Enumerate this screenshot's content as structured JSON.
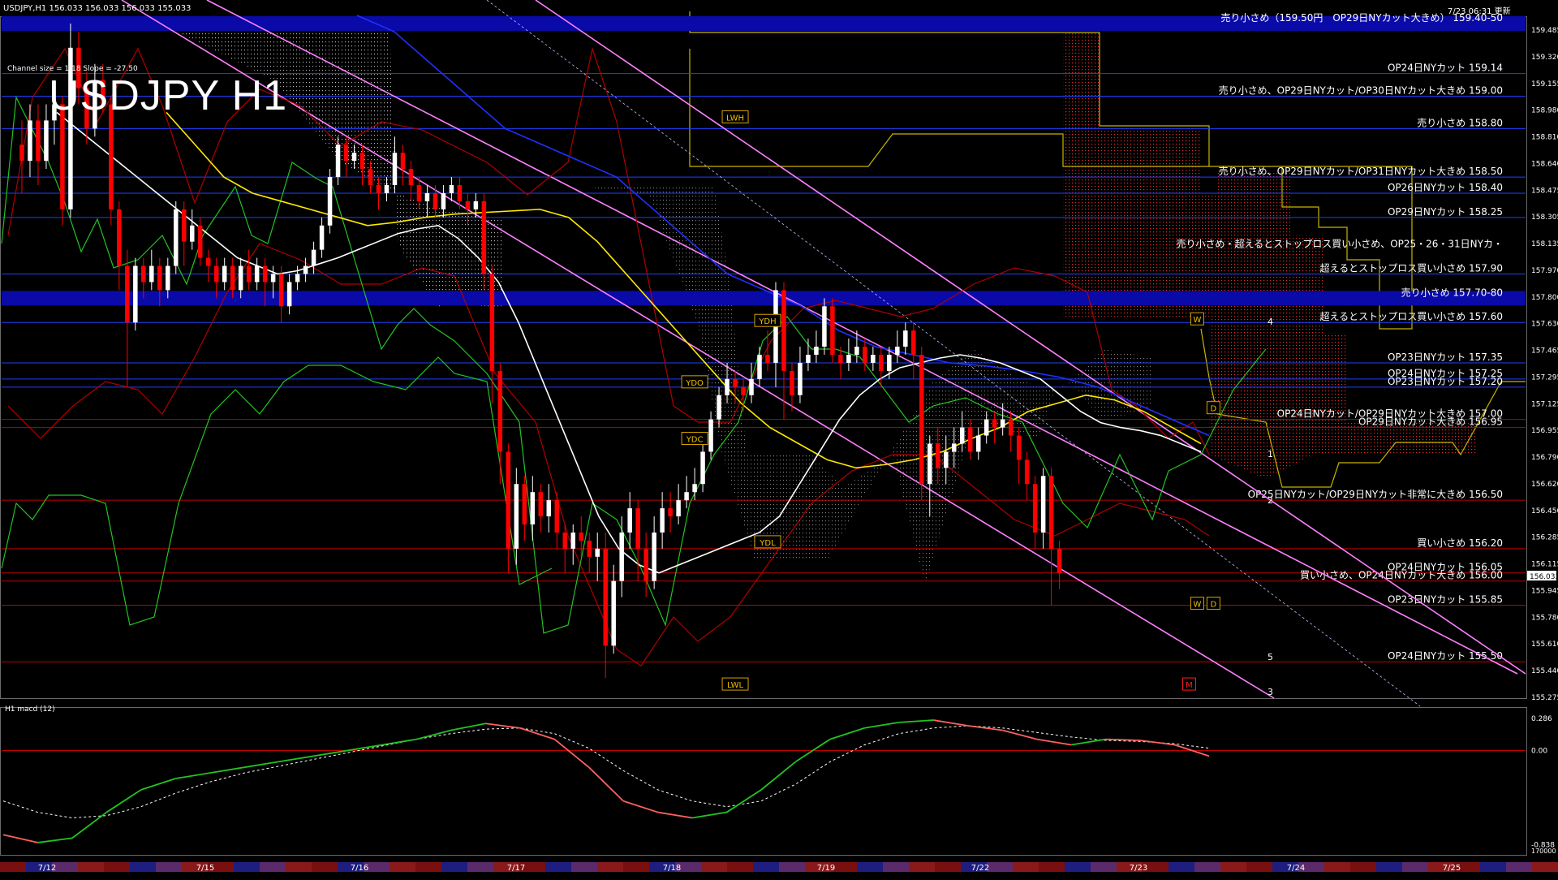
{
  "header": {
    "symbol_info": "USDJPY,H1  156.033 156.033 156.033 155.033",
    "update_time": "7/23 06:31 更新",
    "channel_info": "Channel size = 1.18 Slope = -27.50",
    "title": "USDJPY H1",
    "macd_label": "H1  macd (12)"
  },
  "colors": {
    "background": "#000000",
    "bull_candle": "#ffffff",
    "bear_candle": "#ff0000",
    "level_line_blue": "#1f3fff",
    "level_line_red": "#c00000",
    "band_blue": "#0a0aa8",
    "cloud_dots": "#ff3030",
    "channel_pink": "#ff80ff",
    "ma_white": "#ffffff",
    "ma_yellow": "#ffea00",
    "ma_blue": "#2030ff",
    "green_line": "#22c322",
    "kijun_yellow": "#c8b400"
  },
  "chart_data": {
    "type": "candlestick",
    "symbol": "USDJPY",
    "timeframe": "H1",
    "last_price": 156.033,
    "price_axis": {
      "min": 155.275,
      "max": 159.485,
      "ticks": [
        "159.485",
        "159.320",
        "159.155",
        "158.980",
        "158.810",
        "158.640",
        "158.475",
        "158.305",
        "158.135",
        "157.970",
        "157.800",
        "157.630",
        "157.465",
        "157.295",
        "157.125",
        "156.955",
        "156.790",
        "156.620",
        "156.450",
        "156.285",
        "156.115",
        "155.945",
        "155.780",
        "155.610",
        "155.440",
        "155.275"
      ]
    },
    "date_axis": [
      "7/12",
      "7/15",
      "7/16",
      "7/17",
      "7/18",
      "7/19",
      "7/22",
      "7/23",
      "7/24",
      "7/25"
    ],
    "price_labels": [
      {
        "text": "売り小さめ（159.50円　OP29日NYカット大きめ） 159.40-50",
        "price": 159.45,
        "kind": "band"
      },
      {
        "text": "OP24日NYカット 159.14",
        "price": 159.14,
        "kind": "blue"
      },
      {
        "text": "売り小さめ、OP29日NYカット/OP30日NYカット大きめ 159.00",
        "price": 159.0,
        "kind": "blue"
      },
      {
        "text": "売り小さめ 158.80",
        "price": 158.8,
        "kind": "blue"
      },
      {
        "text": "売り小さめ、OP29日NYカット/OP31日NYカット大きめ 158.50",
        "price": 158.5,
        "kind": "blue"
      },
      {
        "text": "OP26日NYカット 158.40",
        "price": 158.4,
        "kind": "blue"
      },
      {
        "text": "OP29日NYカット 158.25",
        "price": 158.25,
        "kind": "blue"
      },
      {
        "text": "売り小さめ・超えるとストップロス買い小さめ、OP25・26・31日NYカ・",
        "price": 158.05,
        "kind": "none"
      },
      {
        "text": "超えるとストップロス買い小さめ 157.90",
        "price": 157.9,
        "kind": "blue"
      },
      {
        "text": "売り小さめ 157.70-80",
        "price": 157.75,
        "kind": "band"
      },
      {
        "text": "超えるとストップロス買い小さめ 157.60",
        "price": 157.6,
        "kind": "blue"
      },
      {
        "text": "OP23日NYカット 157.35",
        "price": 157.35,
        "kind": "blue"
      },
      {
        "text": "OP24日NYカット 157.25",
        "price": 157.25,
        "kind": "blue"
      },
      {
        "text": "OP23日NYカット 157.20",
        "price": 157.2,
        "kind": "blue"
      },
      {
        "text": "OP24日NYカット/OP29日NYカット大きめ 157.00",
        "price": 157.0,
        "kind": "red"
      },
      {
        "text": "OP29日NYカット大きめ 156.95",
        "price": 156.95,
        "kind": "red"
      },
      {
        "text": "OP25日NYカット/OP29日NYカット非常に大きめ 156.50",
        "price": 156.5,
        "kind": "red"
      },
      {
        "text": "買い小さめ 156.20",
        "price": 156.2,
        "kind": "red"
      },
      {
        "text": "OP24日NYカット 156.05",
        "price": 156.05,
        "kind": "red"
      },
      {
        "text": "買い小さめ、OP24日NYカット大きめ 156.00",
        "price": 156.0,
        "kind": "red"
      },
      {
        "text": "OP23日NYカット 155.85",
        "price": 155.85,
        "kind": "red"
      },
      {
        "text": "OP24日NYカット 155.50",
        "price": 155.5,
        "kind": "red"
      }
    ],
    "chart_tags": [
      {
        "text": "LWH",
        "price": 158.87,
        "bar": 88
      },
      {
        "text": "YDH",
        "price": 157.61,
        "bar": 92
      },
      {
        "text": "YDO",
        "price": 157.23,
        "bar": 83
      },
      {
        "text": "YDC",
        "price": 156.88,
        "bar": 83
      },
      {
        "text": "YDL",
        "price": 156.24,
        "bar": 92
      },
      {
        "text": "LWL",
        "price": 155.36,
        "bar": 88
      },
      {
        "text": "W",
        "price": 157.62,
        "bar": 145
      },
      {
        "text": "D",
        "price": 157.07,
        "bar": 147
      },
      {
        "text": "W",
        "price": 155.86,
        "bar": 145
      },
      {
        "text": "D",
        "price": 155.86,
        "bar": 147
      },
      {
        "text": "M",
        "price": 155.36,
        "bar": 144
      }
    ],
    "wave_labels": [
      "4",
      "1",
      "2",
      "5",
      "3"
    ],
    "candles": [
      [
        158.7,
        158.6,
        158.85,
        158.4
      ],
      [
        158.6,
        158.85,
        158.95,
        158.5
      ],
      [
        158.85,
        158.6,
        158.95,
        158.45
      ],
      [
        158.6,
        158.85,
        158.95,
        158.55
      ],
      [
        158.85,
        158.95,
        159.1,
        158.7
      ],
      [
        158.95,
        158.3,
        159.0,
        158.2
      ],
      [
        158.3,
        159.3,
        159.45,
        158.25
      ],
      [
        159.3,
        159.05,
        159.4,
        158.95
      ],
      [
        159.05,
        158.8,
        159.15,
        158.7
      ],
      [
        158.8,
        159.1,
        159.2,
        158.75
      ],
      [
        159.1,
        158.95,
        159.2,
        158.9
      ],
      [
        158.95,
        158.3,
        159.0,
        158.2
      ],
      [
        158.3,
        157.95,
        158.35,
        157.8
      ],
      [
        157.95,
        157.6,
        158.05,
        157.2
      ],
      [
        157.6,
        157.95,
        158.0,
        157.55
      ],
      [
        157.95,
        157.85,
        158.0,
        157.75
      ],
      [
        157.85,
        157.95,
        158.05,
        157.8
      ],
      [
        157.95,
        157.8,
        158.0,
        157.7
      ],
      [
        157.8,
        157.95,
        158.0,
        157.75
      ],
      [
        157.95,
        158.3,
        158.35,
        157.9
      ],
      [
        158.3,
        158.1,
        158.35,
        157.95
      ],
      [
        158.1,
        158.2,
        158.3,
        158.05
      ],
      [
        158.2,
        158.0,
        158.25,
        157.95
      ],
      [
        158.0,
        157.95,
        158.05,
        157.85
      ],
      [
        157.95,
        157.85,
        158.0,
        157.75
      ],
      [
        157.85,
        157.95,
        158.0,
        157.8
      ],
      [
        157.95,
        157.8,
        158.0,
        157.75
      ],
      [
        157.8,
        157.95,
        158.0,
        157.75
      ],
      [
        157.95,
        157.85,
        158.05,
        157.8
      ],
      [
        157.85,
        157.95,
        158.0,
        157.8
      ],
      [
        157.95,
        157.85,
        158.0,
        157.7
      ],
      [
        157.85,
        157.9,
        157.95,
        157.75
      ],
      [
        157.9,
        157.7,
        157.95,
        157.6
      ],
      [
        157.7,
        157.85,
        157.9,
        157.65
      ],
      [
        157.85,
        157.9,
        157.95,
        157.8
      ],
      [
        157.9,
        157.95,
        158.0,
        157.85
      ],
      [
        157.95,
        158.05,
        158.1,
        157.9
      ],
      [
        158.05,
        158.2,
        158.25,
        158.0
      ],
      [
        158.2,
        158.5,
        158.55,
        158.15
      ],
      [
        158.5,
        158.7,
        158.75,
        158.45
      ],
      [
        158.7,
        158.6,
        158.75,
        158.5
      ],
      [
        158.6,
        158.65,
        158.7,
        158.55
      ],
      [
        158.65,
        158.55,
        158.7,
        158.45
      ],
      [
        158.55,
        158.45,
        158.6,
        158.4
      ],
      [
        158.45,
        158.4,
        158.5,
        158.3
      ],
      [
        158.4,
        158.45,
        158.5,
        158.35
      ],
      [
        158.45,
        158.65,
        158.75,
        158.4
      ],
      [
        158.65,
        158.55,
        158.7,
        158.45
      ],
      [
        158.55,
        158.45,
        158.6,
        158.35
      ],
      [
        158.45,
        158.35,
        158.5,
        158.3
      ],
      [
        158.35,
        158.4,
        158.45,
        158.25
      ],
      [
        158.4,
        158.3,
        158.45,
        158.25
      ],
      [
        158.3,
        158.4,
        158.45,
        158.25
      ],
      [
        158.4,
        158.45,
        158.5,
        158.35
      ],
      [
        158.45,
        158.35,
        158.5,
        158.3
      ],
      [
        158.35,
        158.3,
        158.4,
        158.2
      ],
      [
        158.3,
        158.35,
        158.4,
        158.25
      ],
      [
        158.35,
        157.9,
        158.4,
        157.8
      ],
      [
        157.9,
        157.3,
        157.95,
        157.1
      ],
      [
        157.3,
        156.8,
        157.35,
        156.6
      ],
      [
        156.8,
        156.2,
        156.85,
        156.05
      ],
      [
        156.2,
        156.6,
        156.7,
        156.1
      ],
      [
        156.6,
        156.35,
        156.65,
        156.25
      ],
      [
        156.35,
        156.55,
        156.65,
        156.25
      ],
      [
        156.55,
        156.4,
        156.6,
        156.3
      ],
      [
        156.4,
        156.5,
        156.6,
        156.3
      ],
      [
        156.5,
        156.3,
        156.55,
        156.2
      ],
      [
        156.3,
        156.2,
        156.35,
        156.05
      ],
      [
        156.2,
        156.3,
        156.35,
        156.1
      ],
      [
        156.3,
        156.25,
        156.4,
        156.15
      ],
      [
        156.25,
        156.15,
        156.3,
        156.05
      ],
      [
        156.15,
        156.2,
        156.3,
        156.0
      ],
      [
        156.2,
        155.6,
        156.3,
        155.4
      ],
      [
        155.6,
        156.0,
        156.1,
        155.55
      ],
      [
        156.0,
        156.3,
        156.4,
        155.9
      ],
      [
        156.3,
        156.45,
        156.55,
        156.2
      ],
      [
        156.45,
        156.2,
        156.5,
        156.0
      ],
      [
        156.2,
        156.0,
        156.3,
        155.9
      ],
      [
        156.0,
        156.3,
        156.4,
        155.95
      ],
      [
        156.3,
        156.45,
        156.55,
        156.2
      ],
      [
        156.45,
        156.4,
        156.55,
        156.3
      ],
      [
        156.4,
        156.5,
        156.6,
        156.35
      ],
      [
        156.5,
        156.55,
        156.65,
        156.45
      ],
      [
        156.55,
        156.6,
        156.7,
        156.5
      ],
      [
        156.6,
        156.8,
        156.85,
        156.55
      ],
      [
        156.8,
        157.0,
        157.05,
        156.75
      ],
      [
        157.0,
        157.15,
        157.2,
        156.95
      ],
      [
        157.15,
        157.25,
        157.35,
        157.1
      ],
      [
        157.25,
        157.2,
        157.3,
        157.1
      ],
      [
        157.2,
        157.15,
        157.25,
        157.05
      ],
      [
        157.15,
        157.25,
        157.35,
        157.1
      ],
      [
        157.25,
        157.4,
        157.45,
        157.2
      ],
      [
        157.4,
        157.35,
        157.55,
        157.3
      ],
      [
        157.35,
        157.8,
        157.85,
        157.2
      ],
      [
        157.8,
        157.3,
        157.85,
        157.0
      ],
      [
        157.3,
        157.15,
        157.35,
        157.05
      ],
      [
        157.15,
        157.35,
        157.45,
        157.1
      ],
      [
        157.35,
        157.4,
        157.5,
        157.3
      ],
      [
        157.4,
        157.45,
        157.55,
        157.35
      ],
      [
        157.45,
        157.7,
        157.75,
        157.4
      ],
      [
        157.7,
        157.4,
        157.75,
        157.35
      ],
      [
        157.4,
        157.35,
        157.45,
        157.25
      ],
      [
        157.35,
        157.4,
        157.5,
        157.3
      ],
      [
        157.4,
        157.45,
        157.55,
        157.35
      ],
      [
        157.45,
        157.35,
        157.5,
        157.3
      ],
      [
        157.35,
        157.4,
        157.45,
        157.3
      ],
      [
        157.4,
        157.3,
        157.45,
        157.2
      ],
      [
        157.3,
        157.4,
        157.45,
        157.25
      ],
      [
        157.4,
        157.45,
        157.55,
        157.35
      ],
      [
        157.45,
        157.55,
        157.6,
        157.4
      ],
      [
        157.55,
        157.4,
        157.6,
        157.25
      ],
      [
        157.4,
        156.6,
        157.45,
        156.5
      ],
      [
        156.6,
        156.85,
        156.9,
        156.4
      ],
      [
        156.85,
        156.7,
        156.95,
        156.6
      ],
      [
        156.7,
        156.8,
        156.9,
        156.6
      ],
      [
        156.8,
        156.85,
        156.95,
        156.7
      ],
      [
        156.85,
        156.95,
        157.05,
        156.8
      ],
      [
        156.95,
        156.8,
        157.0,
        156.75
      ],
      [
        156.8,
        156.9,
        156.95,
        156.75
      ],
      [
        156.9,
        157.0,
        157.05,
        156.85
      ],
      [
        157.0,
        156.95,
        157.05,
        156.85
      ],
      [
        156.95,
        157.0,
        157.1,
        156.9
      ],
      [
        157.0,
        156.9,
        157.05,
        156.8
      ],
      [
        156.9,
        156.75,
        156.95,
        156.6
      ],
      [
        156.75,
        156.6,
        156.8,
        156.5
      ],
      [
        156.6,
        156.3,
        156.65,
        156.2
      ],
      [
        156.3,
        156.65,
        156.7,
        156.2
      ],
      [
        156.65,
        156.2,
        156.7,
        155.85
      ],
      [
        156.2,
        156.05,
        156.25,
        155.95
      ]
    ],
    "ma_white": [
      158.9,
      158.8,
      158.7,
      158.6,
      158.5,
      158.4,
      158.3,
      158.2,
      158.1,
      158.0,
      157.95,
      157.9,
      157.92,
      157.96,
      158.0,
      158.05,
      158.1,
      158.15,
      158.18,
      158.2,
      158.12,
      158.0,
      157.85,
      157.6,
      157.3,
      157.0,
      156.7,
      156.4,
      156.2,
      156.1,
      156.05,
      156.1,
      156.15,
      156.2,
      156.25,
      156.3,
      156.4,
      156.6,
      156.8,
      157.0,
      157.15,
      157.25,
      157.32,
      157.35,
      157.38,
      157.4,
      157.38,
      157.35,
      157.3,
      157.25,
      157.15,
      157.05,
      156.98,
      156.95,
      156.93,
      156.9,
      156.85,
      156.8
    ],
    "ma_yellow": [
      158.9,
      158.7,
      158.5,
      158.4,
      158.35,
      158.3,
      158.25,
      158.2,
      158.22,
      158.25,
      158.27,
      158.28,
      158.29,
      158.3,
      158.25,
      158.1,
      157.9,
      157.7,
      157.5,
      157.3,
      157.1,
      156.95,
      156.85,
      156.75,
      156.7,
      156.72,
      156.75,
      156.8,
      156.88,
      156.95,
      157.05,
      157.1,
      157.15,
      157.12,
      157.05,
      156.95,
      156.85
    ],
    "ma_blue": [
      159.5,
      159.4,
      159.2,
      159.0,
      158.8,
      158.7,
      158.6,
      158.5,
      158.3,
      158.1,
      157.9,
      157.8,
      157.7,
      157.55,
      157.45,
      157.4,
      157.35,
      157.33,
      157.3,
      157.26,
      157.2,
      157.1,
      157.0,
      156.9
    ],
    "macd_line": [
      -0.75,
      -0.82,
      -0.78,
      -0.55,
      -0.35,
      -0.25,
      -0.2,
      -0.15,
      -0.1,
      -0.05,
      0.0,
      0.05,
      0.1,
      0.18,
      0.24,
      0.2,
      0.1,
      -0.15,
      -0.45,
      -0.55,
      -0.6,
      -0.55,
      -0.35,
      -0.1,
      0.1,
      0.2,
      0.25,
      0.27,
      0.22,
      0.18,
      0.1,
      0.05,
      0.1,
      0.09,
      0.05,
      -0.05
    ],
    "macd_signal": [
      -0.45,
      -0.55,
      -0.6,
      -0.58,
      -0.5,
      -0.38,
      -0.28,
      -0.2,
      -0.14,
      -0.08,
      -0.02,
      0.04,
      0.1,
      0.15,
      0.19,
      0.2,
      0.15,
      0.02,
      -0.18,
      -0.35,
      -0.45,
      -0.5,
      -0.45,
      -0.3,
      -0.1,
      0.05,
      0.15,
      0.2,
      0.22,
      0.2,
      0.16,
      0.12,
      0.09,
      0.08,
      0.06,
      0.02
    ],
    "macd_axis": [
      "0.286",
      "0.00",
      "-0.838"
    ],
    "macd_bottom_label": "170000"
  }
}
